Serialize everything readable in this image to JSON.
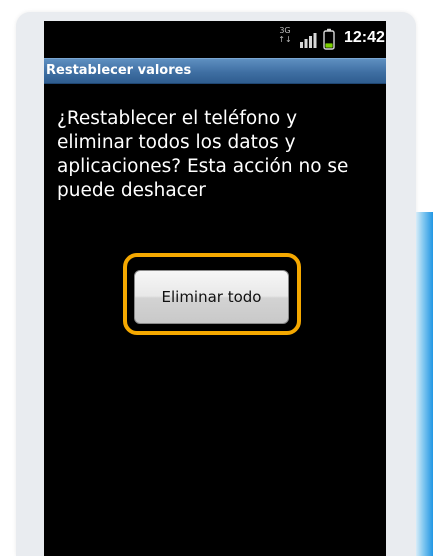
{
  "status_bar": {
    "network_type": "3G",
    "data_arrows": "↑↓",
    "time": "12:42"
  },
  "title_bar": {
    "title": "Restablecer valores"
  },
  "dialog": {
    "message": "¿Restablecer el teléfono y\neliminar todos los datos y\naplicaciones? Esta acción no se\npuede deshacer"
  },
  "actions": {
    "delete_all_label": "Eliminar todo"
  },
  "colors": {
    "highlight_outline": "#f5a800",
    "title_bar": "#3f6fa3",
    "accent_stripe": "#2196e3"
  },
  "icons": {
    "signal": "signal-icon",
    "battery": "battery-icon"
  }
}
